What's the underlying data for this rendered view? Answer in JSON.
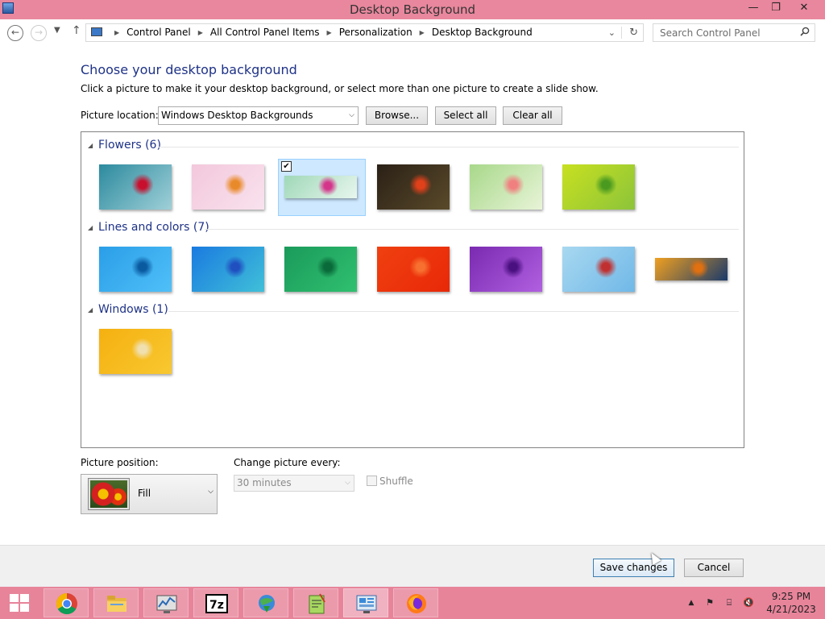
{
  "window": {
    "title": "Desktop Background",
    "minimize_glyph": "—",
    "restore_glyph": "❐",
    "close_glyph": "✕"
  },
  "nav": {
    "back_glyph": "←",
    "forward_glyph": "→",
    "recent_glyph": "▼",
    "up_glyph": "↑",
    "breadcrumbs": [
      "Control Panel",
      "All Control Panel Items",
      "Personalization",
      "Desktop Background"
    ],
    "breadcrumb_separator": "▶",
    "dropdown_glyph": "⌄",
    "refresh_glyph": "↻",
    "search_placeholder": "Search Control Panel"
  },
  "main": {
    "heading": "Choose your desktop background",
    "subtitle": "Click a picture to make it your desktop background, or select more than one picture to create a slide show.",
    "picture_location_label": "Picture location:",
    "picture_location_value": "Windows Desktop Backgrounds",
    "browse_label": "Browse...",
    "select_all_label": "Select all",
    "clear_all_label": "Clear all",
    "dropdown_arrow": "⌵",
    "groups": [
      {
        "label": "Flowers (6)",
        "count": 6,
        "selected_index": 2,
        "thumbs": [
          {
            "name": "red-flower-on-teal",
            "colors": [
              "#2c8a9e",
              "#9fd0d8",
              "#c8102e"
            ]
          },
          {
            "name": "orange-flower-on-pink",
            "colors": [
              "#f3c8dc",
              "#f9e2ee",
              "#e98a2a"
            ]
          },
          {
            "name": "pink-flower-on-mint",
            "colors": [
              "#9fd8b8",
              "#e8f6ee",
              "#d4358a"
            ]
          },
          {
            "name": "red-tulips-dark",
            "colors": [
              "#2a2016",
              "#5a4a2a",
              "#e0401a"
            ]
          },
          {
            "name": "pink-lily-green",
            "colors": [
              "#a8d88a",
              "#e8f4d8",
              "#f08080"
            ]
          },
          {
            "name": "green-leaf-yellow",
            "colors": [
              "#c8e020",
              "#8cc43a",
              "#4a9a20"
            ]
          }
        ]
      },
      {
        "label": "Lines and colors (7)",
        "count": 7,
        "selected_index": -1,
        "thumbs": [
          {
            "name": "blue-lines",
            "colors": [
              "#2a9ee8",
              "#50c0f8",
              "#0a5aa0"
            ]
          },
          {
            "name": "blue-green-fan",
            "colors": [
              "#1a7ae0",
              "#40c0d8",
              "#2050c0"
            ]
          },
          {
            "name": "green-curve",
            "colors": [
              "#1a9a5a",
              "#30c070",
              "#0a6a3a"
            ]
          },
          {
            "name": "orange-swirl",
            "colors": [
              "#f04010",
              "#e82808",
              "#f87030"
            ]
          },
          {
            "name": "purple-waves",
            "colors": [
              "#7a2ab0",
              "#b060e0",
              "#4a1080"
            ]
          },
          {
            "name": "light-blue-stripes",
            "colors": [
              "#a8d8f0",
              "#70b8e8",
              "#c03030"
            ]
          },
          {
            "name": "orange-blocks",
            "colors": [
              "#f0a020",
              "#1a3a6a",
              "#e07010"
            ]
          }
        ]
      },
      {
        "label": "Windows (1)",
        "count": 1,
        "selected_index": -1,
        "thumbs": [
          {
            "name": "windows-orange",
            "colors": [
              "#f5b010",
              "#f8c830",
              "#f0e0b0"
            ]
          }
        ]
      }
    ],
    "checkbox_glyph": "✔"
  },
  "options": {
    "position_label": "Picture position:",
    "position_value": "Fill",
    "change_label": "Change picture every:",
    "change_value": "30 minutes",
    "shuffle_label": "Shuffle"
  },
  "footer": {
    "save_label": "Save changes",
    "cancel_label": "Cancel"
  },
  "taskbar": {
    "apps": [
      "chrome",
      "file-explorer",
      "performance-monitor",
      "7-zip",
      "internet-download-manager",
      "notepad++",
      "control-panel",
      "firefox"
    ],
    "active_app": "control-panel",
    "time": "9:25 PM",
    "date": "4/21/2023",
    "tray_chevron": "▲",
    "tray_flag": "⚑",
    "tray_network": "⌸",
    "tray_volume": "🔇"
  },
  "colors": {
    "title_bar": "#e8879d",
    "taskbar": "#e7849a",
    "heading_blue": "#1e3287"
  }
}
